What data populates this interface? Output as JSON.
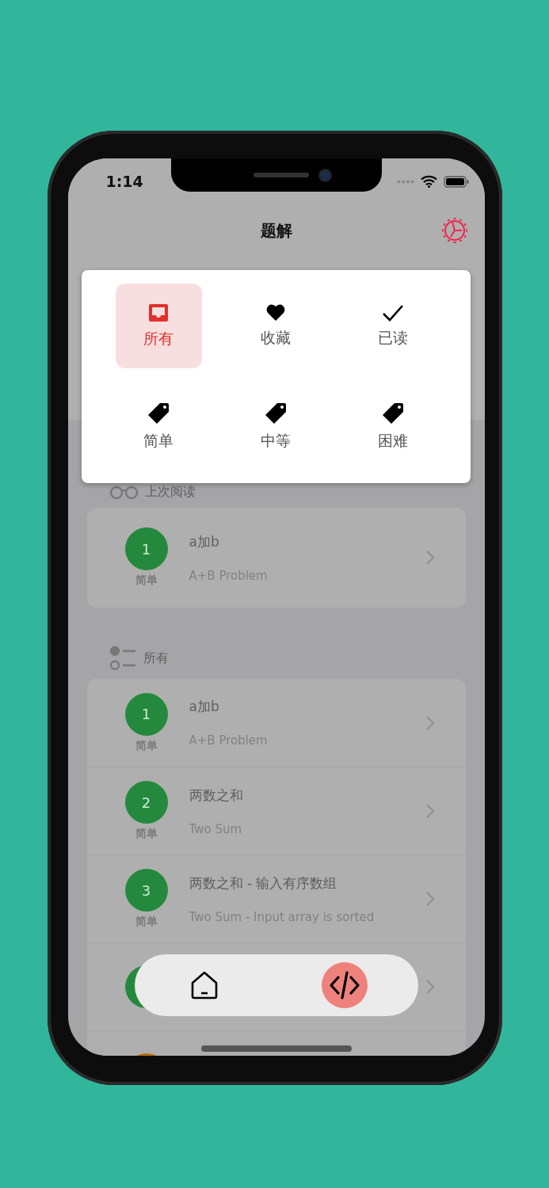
{
  "status_bar": {
    "time": "1:14"
  },
  "header": {
    "title": "题解"
  },
  "filter_menu": {
    "items": [
      {
        "label": "所有",
        "kind": "inbox",
        "selected": true
      },
      {
        "label": "收藏",
        "kind": "heart",
        "selected": false
      },
      {
        "label": "已读",
        "kind": "check",
        "selected": false
      },
      {
        "label": "简单",
        "kind": "tag",
        "selected": false
      },
      {
        "label": "中等",
        "kind": "tag",
        "selected": false
      },
      {
        "label": "困难",
        "kind": "tag",
        "selected": false
      }
    ]
  },
  "last_read": {
    "heading": "上次阅读",
    "rows": [
      {
        "number": "1",
        "difficulty": "简单",
        "title": "a加b",
        "subtitle": "A+B Problem",
        "color": "#25893d"
      }
    ]
  },
  "all": {
    "heading": "所有",
    "rows": [
      {
        "number": "1",
        "difficulty": "简单",
        "title": "a加b",
        "subtitle": "A+B Problem",
        "color": "#25893d"
      },
      {
        "number": "2",
        "difficulty": "简单",
        "title": "两数之和",
        "subtitle": "Two Sum",
        "color": "#25893d"
      },
      {
        "number": "3",
        "difficulty": "简单",
        "title": "两数之和 - 输入有序数组",
        "subtitle": "Two Sum - Input array is sorted",
        "color": "#25893d"
      },
      {
        "color": "#25893d"
      },
      {
        "color": "#b86f0e"
      }
    ]
  },
  "tab_bar": {
    "items": [
      {
        "kind": "home",
        "selected": false
      },
      {
        "kind": "code",
        "selected": true
      }
    ]
  }
}
